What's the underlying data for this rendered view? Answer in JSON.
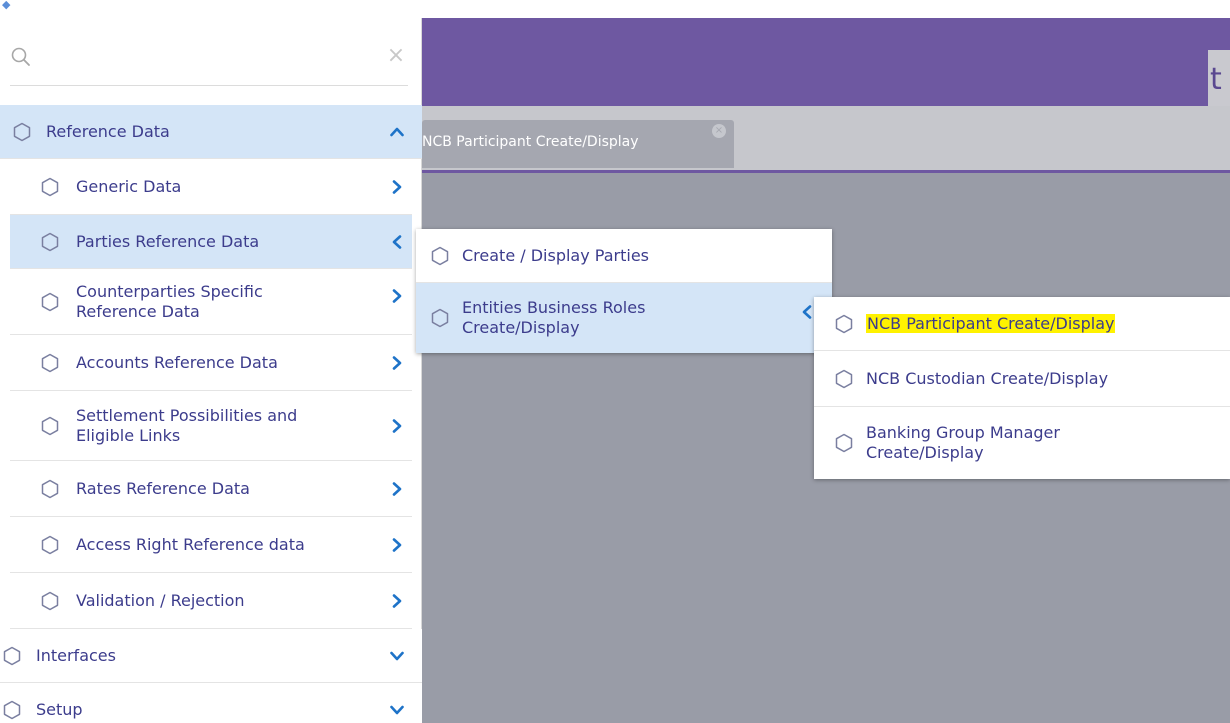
{
  "app": {
    "logo_glyph": "t",
    "tab_label": "NCB Participant Create/Display",
    "tab_close": "×"
  },
  "search": {
    "placeholder": "",
    "value": "",
    "clear_glyph": "×"
  },
  "menu": {
    "items": [
      {
        "label": "Reference Data",
        "level": 0,
        "expanded": true
      },
      {
        "label": "Generic Data",
        "level": 1
      },
      {
        "label": "Parties Reference Data",
        "level": 1,
        "open": true
      },
      {
        "label": "Counterparties Specific Reference Data",
        "level": 1
      },
      {
        "label": "Accounts Reference Data",
        "level": 1
      },
      {
        "label": "Settlement Possibilities and Eligible Links",
        "level": 1
      },
      {
        "label": "Rates Reference Data",
        "level": 1
      },
      {
        "label": "Access Right Reference data",
        "level": 1
      },
      {
        "label": "Validation / Rejection",
        "level": 1
      },
      {
        "label": "Interfaces",
        "level": 0
      },
      {
        "label": "Setup",
        "level": 0
      }
    ],
    "item_labels_multi": {
      "counterparties_1": "Counterparties Specific",
      "counterparties_2": "Reference Data",
      "settlement_1": "Settlement Possibilities and",
      "settlement_2": "Eligible Links"
    }
  },
  "flyout1": {
    "items": [
      {
        "label": "Create / Display Parties"
      },
      {
        "label_1": "Entities Business Roles",
        "label_2": "Create/Display",
        "open": true
      }
    ]
  },
  "flyout2": {
    "items": [
      {
        "label": "NCB Participant Create/Display",
        "highlighted": true
      },
      {
        "label": "NCB Custodian Create/Display"
      },
      {
        "label_1": "Banking Group Manager",
        "label_2": "Create/Display"
      }
    ]
  },
  "colors": {
    "header": "#6e58a1",
    "active_row": "#d4e5f7",
    "menu_text": "#3c3c8c",
    "chevron": "#1e73c8",
    "highlight": "#fff200",
    "workspace": "#999ca7"
  },
  "icons": {
    "menu_item_icon": "hexagon-outline-icon",
    "search_icon": "magnifier-icon",
    "expand_icon": "chevron-icon"
  }
}
